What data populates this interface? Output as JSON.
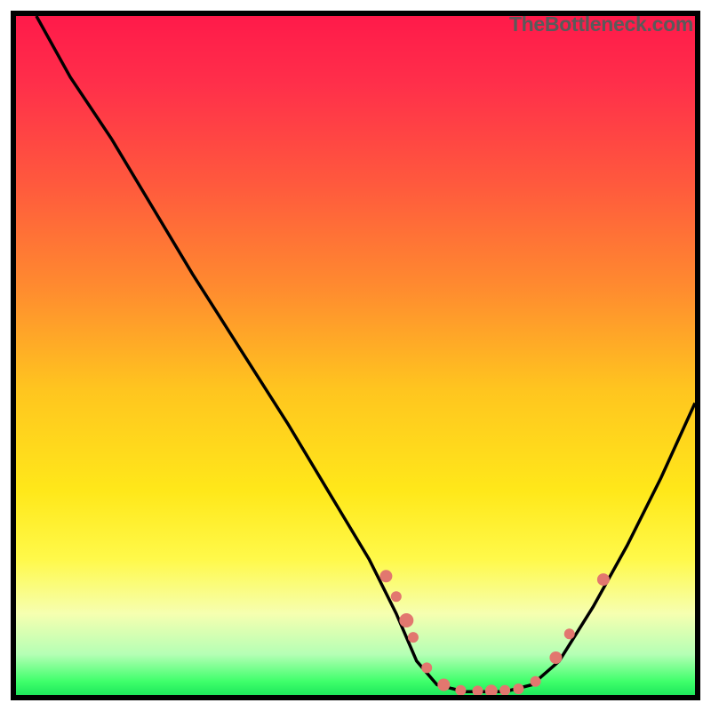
{
  "watermark": "TheBottleneck.com",
  "chart_data": {
    "type": "line",
    "title": "",
    "xlabel": "",
    "ylabel": "",
    "xlim": [
      0,
      100
    ],
    "ylim": [
      0,
      100
    ],
    "curve": [
      {
        "x": 3,
        "y": 100
      },
      {
        "x": 8,
        "y": 91
      },
      {
        "x": 14,
        "y": 82
      },
      {
        "x": 20,
        "y": 72
      },
      {
        "x": 26,
        "y": 62
      },
      {
        "x": 33,
        "y": 51
      },
      {
        "x": 40,
        "y": 40
      },
      {
        "x": 46,
        "y": 30
      },
      {
        "x": 52,
        "y": 20
      },
      {
        "x": 56,
        "y": 12
      },
      {
        "x": 59,
        "y": 5
      },
      {
        "x": 62,
        "y": 1.5
      },
      {
        "x": 66,
        "y": 0.5
      },
      {
        "x": 72,
        "y": 0.5
      },
      {
        "x": 76,
        "y": 1.5
      },
      {
        "x": 80,
        "y": 5
      },
      {
        "x": 85,
        "y": 13
      },
      {
        "x": 90,
        "y": 22
      },
      {
        "x": 95,
        "y": 32
      },
      {
        "x": 100,
        "y": 43
      }
    ],
    "dots": [
      {
        "x": 54.5,
        "y": 17.5,
        "r": 7
      },
      {
        "x": 56,
        "y": 14.5,
        "r": 6
      },
      {
        "x": 57.5,
        "y": 11,
        "r": 8
      },
      {
        "x": 58.5,
        "y": 8.5,
        "r": 6
      },
      {
        "x": 60.5,
        "y": 4,
        "r": 6
      },
      {
        "x": 63,
        "y": 1.5,
        "r": 7
      },
      {
        "x": 65.5,
        "y": 0.7,
        "r": 6
      },
      {
        "x": 68,
        "y": 0.6,
        "r": 6
      },
      {
        "x": 70,
        "y": 0.6,
        "r": 7
      },
      {
        "x": 72,
        "y": 0.7,
        "r": 6
      },
      {
        "x": 74,
        "y": 0.9,
        "r": 6
      },
      {
        "x": 76.5,
        "y": 2,
        "r": 6
      },
      {
        "x": 79.5,
        "y": 5.5,
        "r": 7
      },
      {
        "x": 81.5,
        "y": 9,
        "r": 6
      },
      {
        "x": 86.5,
        "y": 17,
        "r": 7
      }
    ],
    "dot_color": "#e2776f",
    "curve_color": "#000000"
  }
}
